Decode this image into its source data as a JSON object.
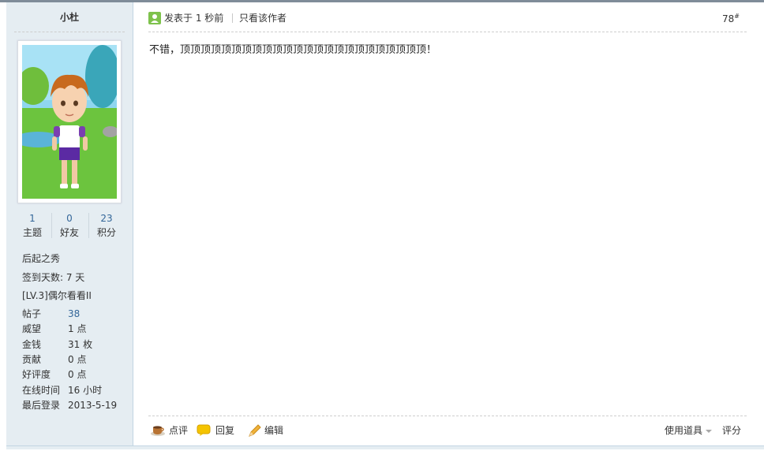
{
  "user": {
    "name": "小杜",
    "stats": [
      {
        "value": "1",
        "label": "主题"
      },
      {
        "value": "0",
        "label": "好友"
      },
      {
        "value": "23",
        "label": "积分"
      }
    ],
    "rank": "后起之秀",
    "checkin": "签到天数: 7 天",
    "level": "[LV.3]偶尔看看II",
    "details": [
      {
        "key": "帖子",
        "value": "38"
      },
      {
        "key": "威望",
        "value": "1 点"
      },
      {
        "key": "金钱",
        "value": "31 枚"
      },
      {
        "key": "贡献",
        "value": "0 点"
      },
      {
        "key": "好评度",
        "value": "0 点"
      },
      {
        "key": "在线时间",
        "value": "16 小时"
      },
      {
        "key": "最后登录",
        "value": "2013-5-19"
      }
    ]
  },
  "post": {
    "time": "发表于 1 秒前",
    "only_author": "只看该作者",
    "floor": "78",
    "floor_mark": "#",
    "content": "不错，顶顶顶顶顶顶顶顶顶顶顶顶顶顶顶顶顶顶顶顶顶顶顶顶！"
  },
  "actions": {
    "comment": "点评",
    "reply": "回复",
    "edit": "编辑",
    "tools": "使用道具",
    "rate": "评分"
  },
  "icons": {
    "poster": "user-online-icon",
    "comment": "coffee-cup-icon",
    "reply": "speech-bubble-icon",
    "edit": "pencil-icon",
    "tools_arrow": "caret-down-icon"
  }
}
